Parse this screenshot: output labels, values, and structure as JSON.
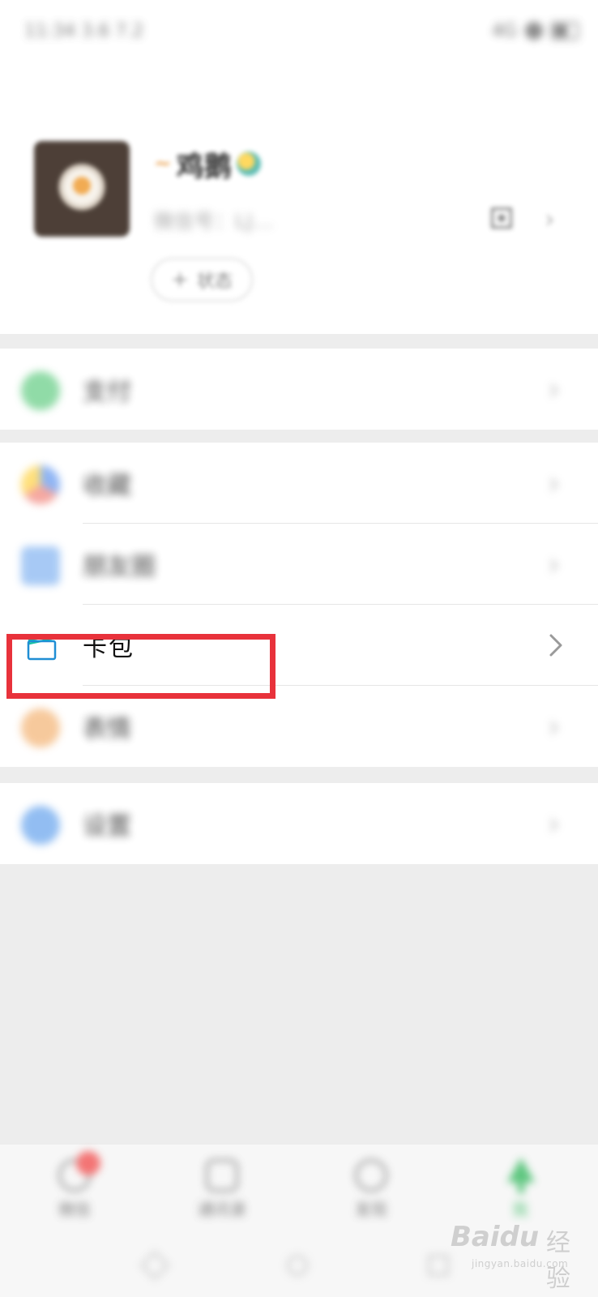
{
  "status_bar": {
    "time": "11:34 3.6 7.2",
    "right": "4G"
  },
  "profile": {
    "nickname_prefix": "~",
    "nickname": "鸡鹅",
    "wechat_id": "微信号：LJ...",
    "status_button": "状态"
  },
  "groups": {
    "pay": {
      "label": "支付"
    },
    "services": [
      {
        "label": "收藏"
      },
      {
        "label": "朋友圈"
      },
      {
        "label": "卡包"
      },
      {
        "label": "表情"
      }
    ],
    "settings": {
      "label": "设置"
    }
  },
  "tabbar": {
    "tabs": [
      {
        "label": "微信"
      },
      {
        "label": "通讯录"
      },
      {
        "label": "发现"
      },
      {
        "label": "我"
      }
    ]
  },
  "watermark": {
    "brand": "Baidu",
    "sub": "经验",
    "url": "jingyan.baidu.com"
  },
  "colors": {
    "highlight": "#e8323b",
    "accent_green": "#2bb657",
    "wallet_blue": "#1f8ed4",
    "wallet_teal": "#19c2a5"
  }
}
